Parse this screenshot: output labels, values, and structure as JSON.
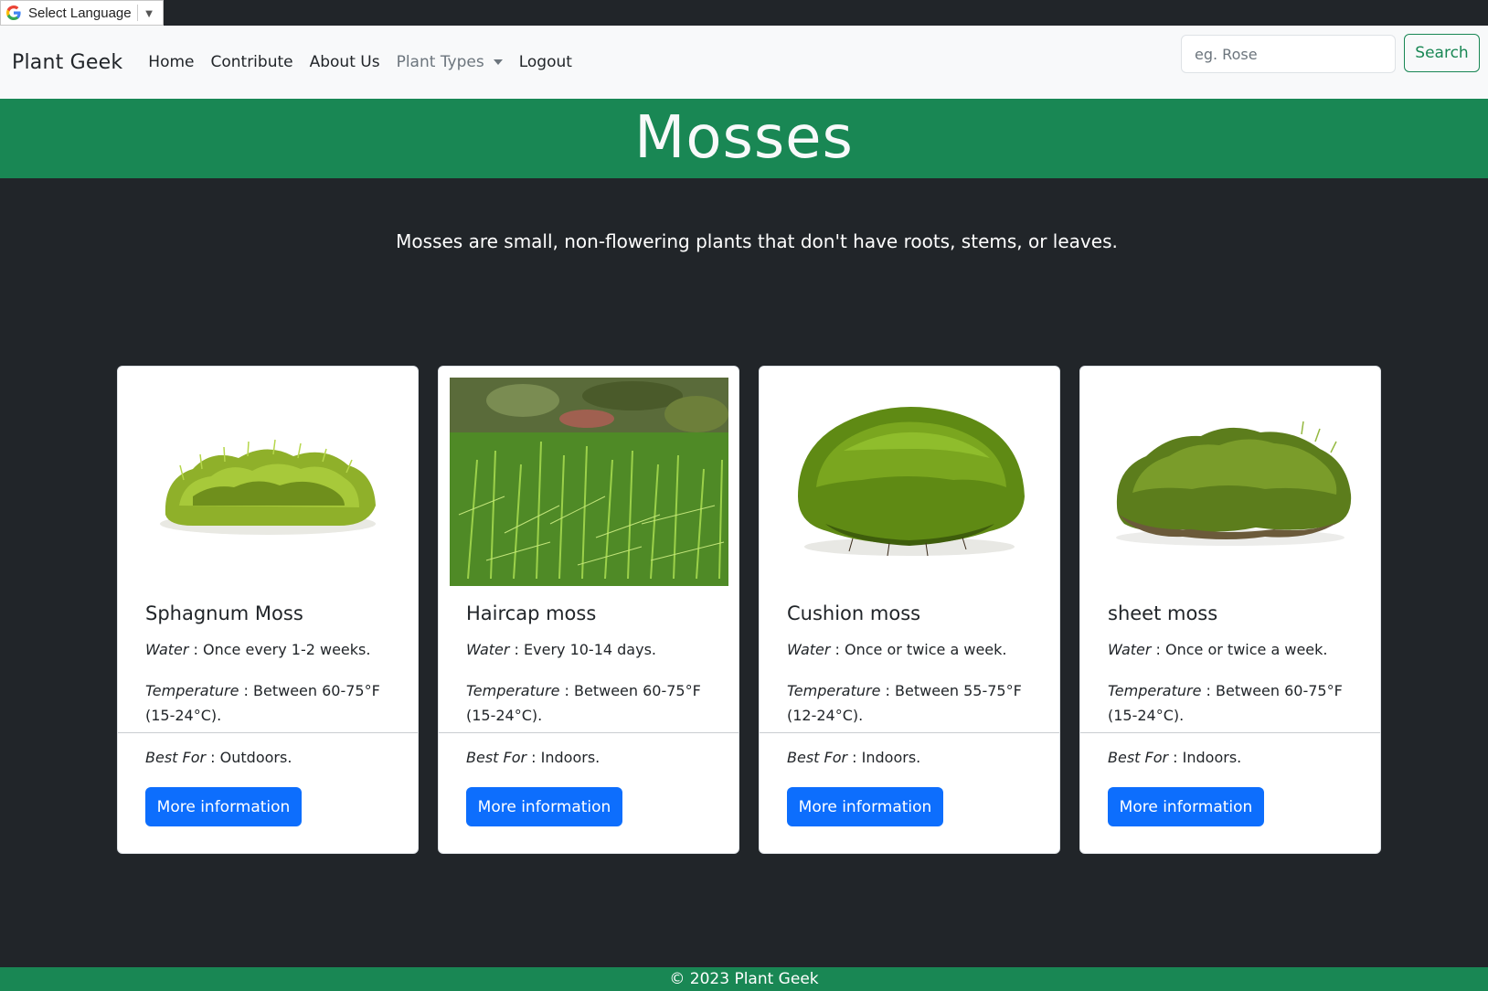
{
  "translate": {
    "label": "Select Language",
    "arrow": "▼"
  },
  "navbar": {
    "brand": "Plant Geek",
    "links": [
      "Home",
      "Contribute",
      "About Us",
      "Plant Types",
      "Logout"
    ],
    "search_placeholder": "eg. Rose",
    "search_button": "Search"
  },
  "hero": {
    "title": "Mosses"
  },
  "intro": "Mosses are small, non-flowering plants that don't have roots, stems, or leaves.",
  "cards": [
    {
      "title": "Sphagnum Moss",
      "water_label": "Water",
      "water": " : Once every 1-2 weeks.",
      "temp_label": "Temperature",
      "temp": " : Between 60-75°F (15-24°C).",
      "best_label": "Best For",
      "best": " : Outdoors.",
      "button": "More information"
    },
    {
      "title": "Haircap moss",
      "water_label": "Water",
      "water": " : Every 10-14 days.",
      "temp_label": "Temperature",
      "temp": " : Between 60-75°F (15-24°C).",
      "best_label": "Best For",
      "best": " : Indoors.",
      "button": "More information"
    },
    {
      "title": "Cushion moss",
      "water_label": "Water",
      "water": " : Once or twice a week.",
      "temp_label": "Temperature",
      "temp": " : Between 55-75°F (12-24°C).",
      "best_label": "Best For",
      "best": " : Indoors.",
      "button": "More information"
    },
    {
      "title": "sheet moss",
      "water_label": "Water",
      "water": " : Once or twice a week.",
      "temp_label": "Temperature",
      "temp": " : Between 60-75°F (15-24°C).",
      "best_label": "Best For",
      "best": " : Indoors.",
      "button": "More information"
    }
  ],
  "footer": "© 2023 Plant Geek",
  "colors": {
    "green": "#198754",
    "dark_bg": "#212529",
    "primary": "#0d6efd",
    "navbar_bg": "#f8f9fa"
  }
}
